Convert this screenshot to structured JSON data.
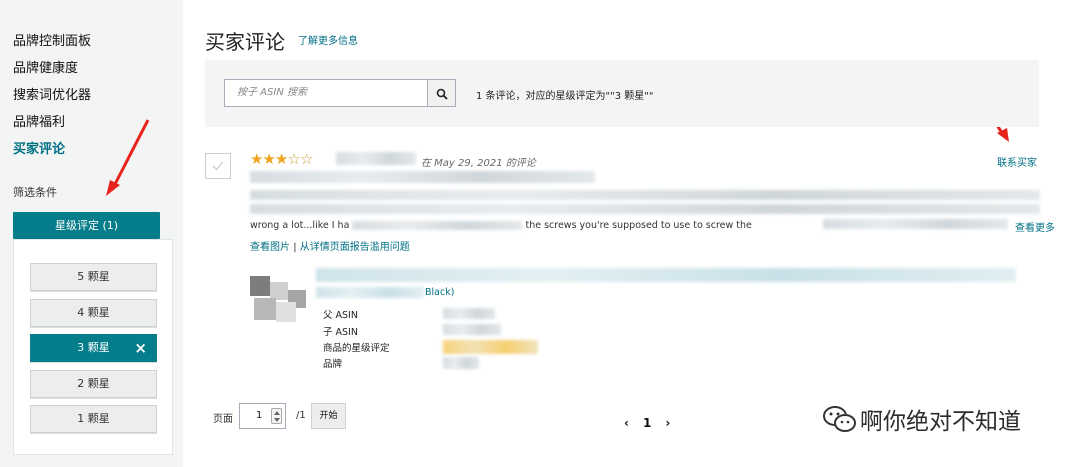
{
  "sidebar": {
    "items": [
      {
        "label": "品牌控制面板"
      },
      {
        "label": "品牌健康度"
      },
      {
        "label": "搜索词优化器"
      },
      {
        "label": "品牌福利"
      },
      {
        "label": "买家评论"
      }
    ],
    "active_index": 4,
    "filter_title": "筛选条件",
    "filter_header": "星级评定 (1)",
    "star_options": [
      {
        "label": "5 颗星"
      },
      {
        "label": "4 颗星"
      },
      {
        "label": "3 颗星",
        "selected": true
      },
      {
        "label": "2 颗星"
      },
      {
        "label": "1 颗星"
      }
    ],
    "clear_icon": "×"
  },
  "main": {
    "title": "买家评论",
    "more_info_link": "了解更多信息",
    "search": {
      "placeholder": "按子 ASIN 搜索",
      "result_text": "1 条评论，对应的星级评定为\"\"3 颗星\"\""
    },
    "review": {
      "rating": 3,
      "max_rating": 5,
      "date_text": "在 May 29, 2021 的评论",
      "contact_link": "联系买家",
      "body_visible": "wrong a lot...like I ha",
      "body_visible_2": "the screws you're supposed to use to screw the",
      "read_more": "查看更多",
      "links": {
        "view_images": "查看图片",
        "separator": "|",
        "report": "从详情页面报告滥用问题"
      },
      "variant_visible": "Black)",
      "details": {
        "parent_asin": "父 ASIN",
        "child_asin": "子 ASIN",
        "product_rating": "商品的星级评定",
        "brand": "品牌"
      }
    },
    "pagination": {
      "page_label": "页面",
      "current_page": "1",
      "total": "/1",
      "go_button": "开始",
      "prev": "‹",
      "page": "1",
      "next": "›"
    }
  },
  "watermark": {
    "text": "啊你绝对不知道"
  },
  "colors": {
    "accent": "#067d8a",
    "link": "#007185",
    "star": "#f0a41f",
    "arrow": "#e8231d"
  }
}
